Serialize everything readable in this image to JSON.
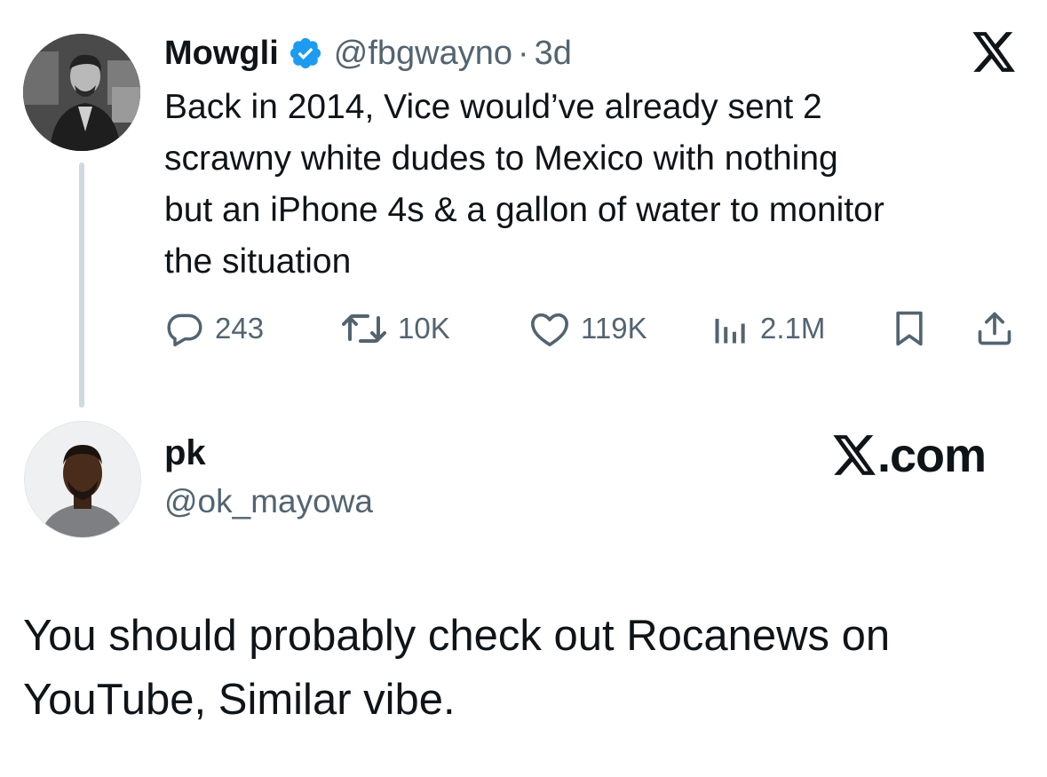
{
  "quoted_tweet": {
    "author_name": "Mowgli",
    "author_handle": "@fbgwayno",
    "separator": "·",
    "time": "3d",
    "verified": true,
    "text_lines": [
      "Back in 2014, Vice would’ve already sent 2",
      "scrawny white dudes to Mexico with nothing",
      "but an iPhone 4s & a gallon of water to monitor",
      "the situation"
    ],
    "actions": {
      "replies": "243",
      "reposts": "10K",
      "likes": "119K",
      "views": "2.1M"
    },
    "icons": [
      "x-logo-icon",
      "verified-badge-icon",
      "reply-icon",
      "repost-icon",
      "like-icon",
      "views-icon",
      "bookmark-icon",
      "share-icon"
    ]
  },
  "reply_user": {
    "name": "pk",
    "handle": "@ok_mayowa",
    "brand": ".com"
  },
  "reply_text_lines": [
    "You should probably check out Rocanews on",
    "YouTube, Similar vibe."
  ],
  "colors": {
    "text": "#0f1419",
    "secondary": "#536471",
    "verified": "#1d9bf0",
    "thread_line": "#cfd9de"
  }
}
